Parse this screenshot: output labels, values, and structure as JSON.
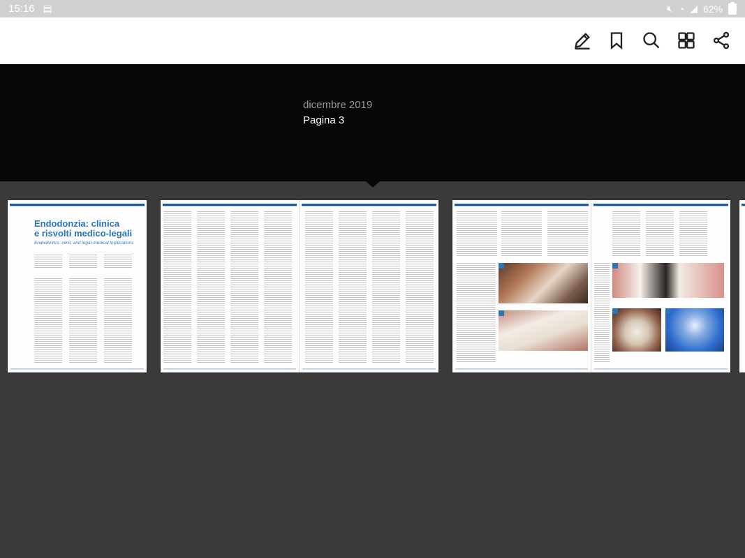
{
  "status_bar": {
    "time": "15:16",
    "battery": "62%",
    "icons": [
      "gallery-icon",
      "mute-icon",
      "wifi-icon",
      "signal-icon",
      "battery-icon"
    ]
  },
  "toolbar": {
    "actions": [
      {
        "name": "annotate",
        "icon": "pencil-icon"
      },
      {
        "name": "bookmark",
        "icon": "bookmark-icon"
      },
      {
        "name": "search",
        "icon": "search-icon"
      },
      {
        "name": "pages",
        "icon": "page-grid-icon"
      },
      {
        "name": "share",
        "icon": "share-icon"
      }
    ]
  },
  "issue": {
    "date": "dicembre 2019",
    "page": "Pagina 3"
  },
  "thumbnails": {
    "article_title_line1": "Endodonzia: clinica",
    "article_title_line2": "e risvolti medico-legali",
    "article_subtitle": "Endodontics: clinic and legal-medical implications"
  },
  "colors": {
    "header_background": "#060606",
    "strip_background": "#3a3a3a",
    "accent_blue": "#2a75b8"
  }
}
